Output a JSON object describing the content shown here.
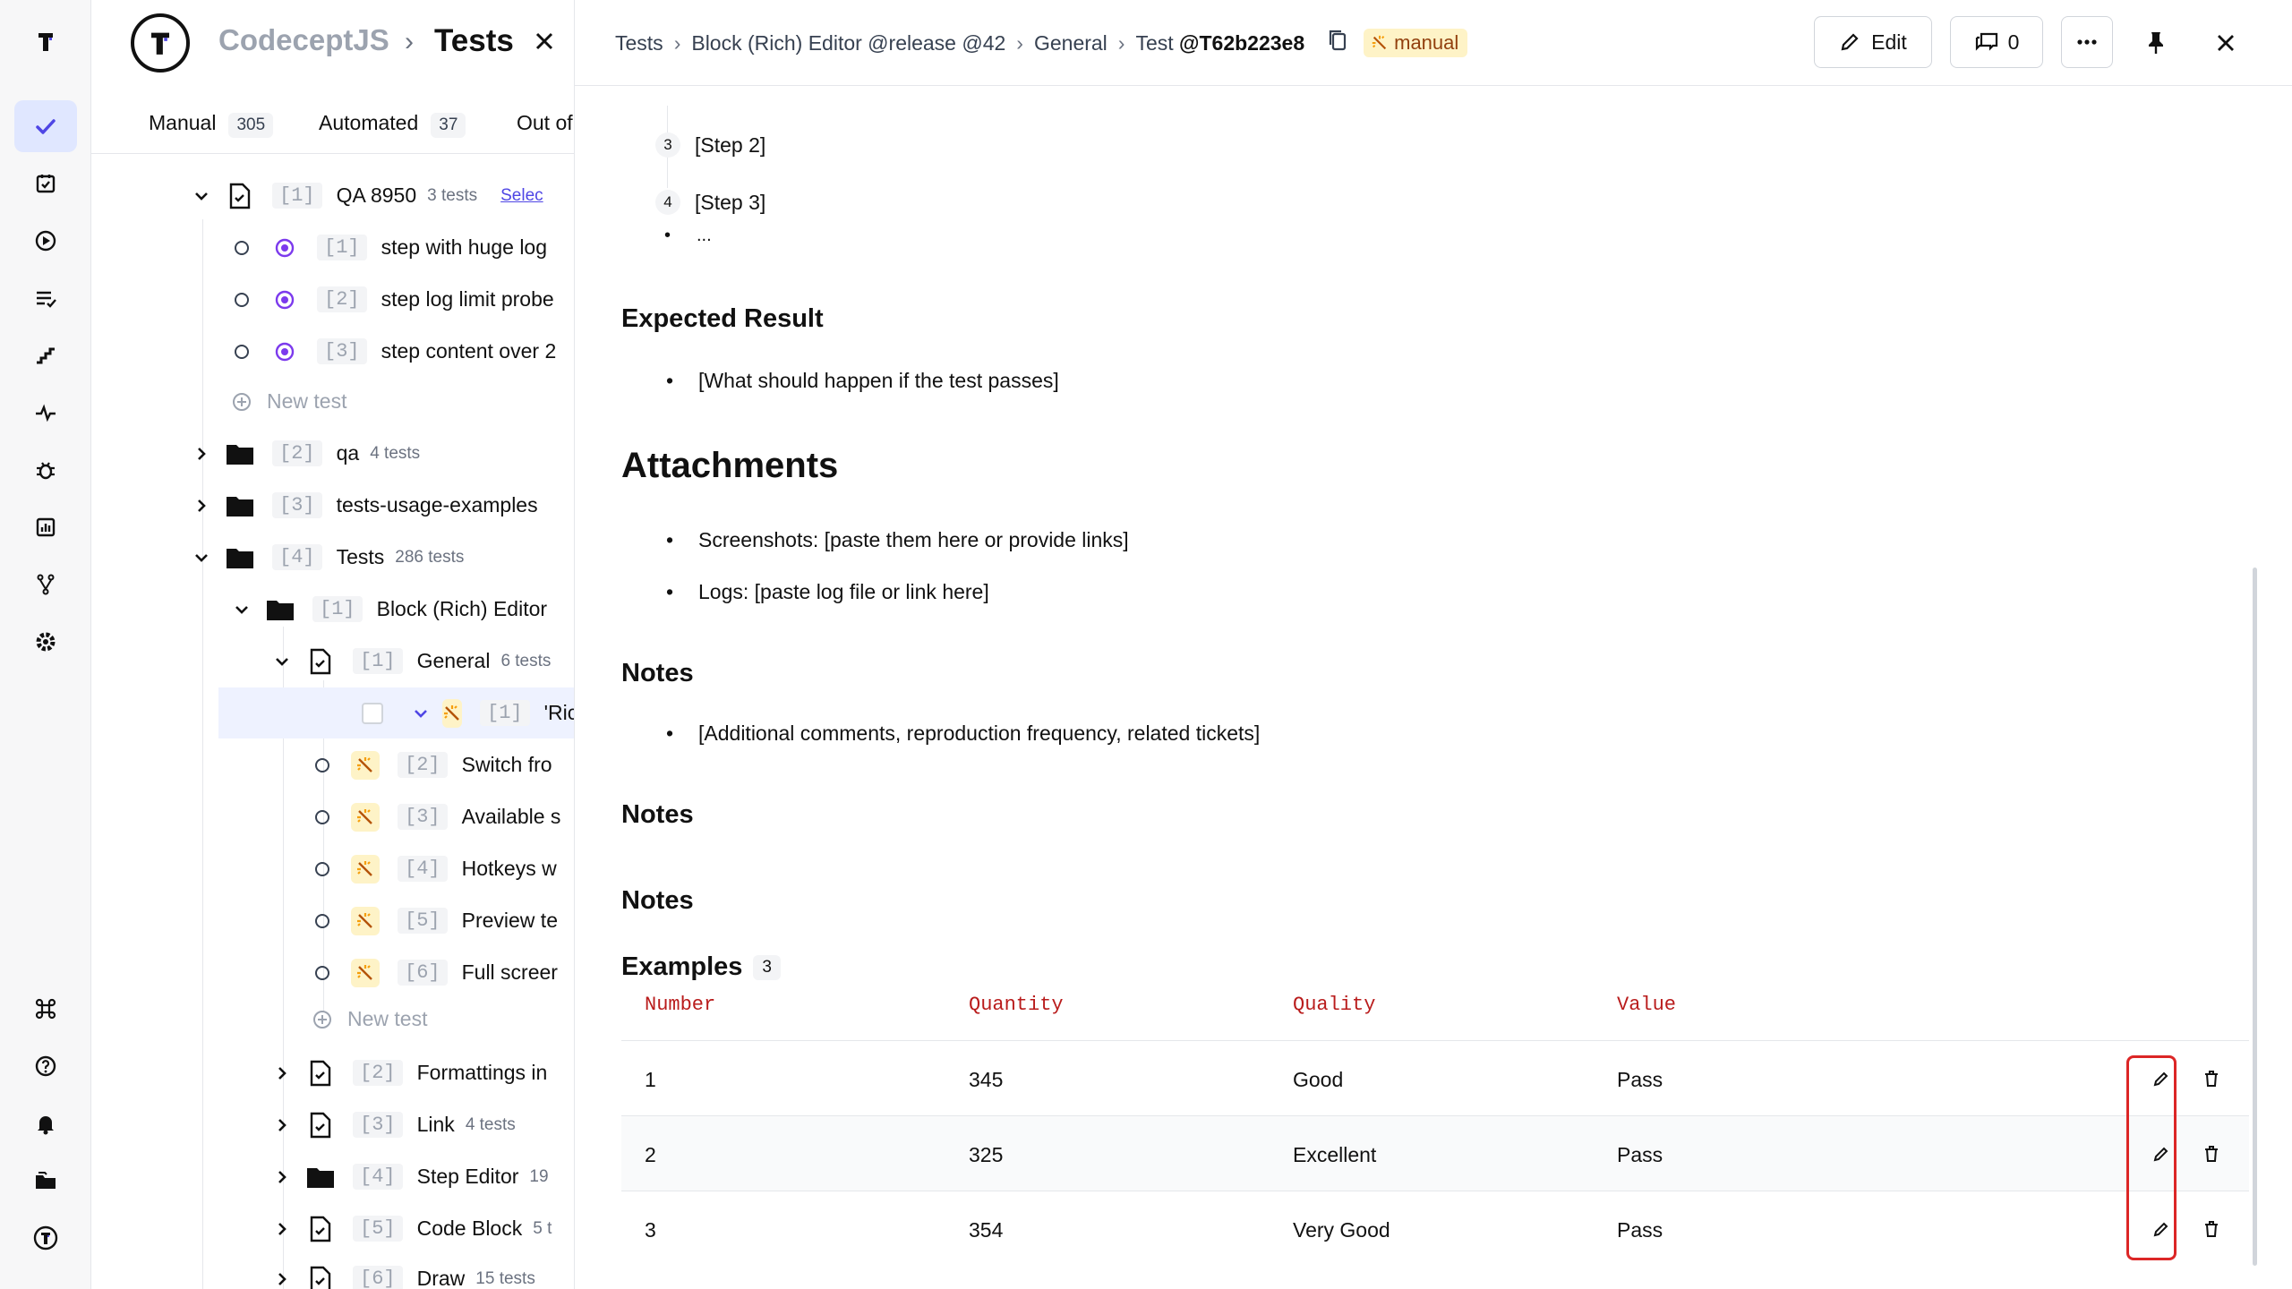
{
  "rail": {
    "items": [
      "logo-icon",
      "tests-icon",
      "checklist-icon",
      "runs-icon",
      "plans-icon",
      "steps-icon",
      "pulse-icon",
      "bug-icon",
      "analytics-icon",
      "branches-icon",
      "settings-icon",
      "command-icon",
      "help-icon",
      "notifications-icon",
      "projects-icon",
      "profile-icon"
    ],
    "accent": "#4f46e5"
  },
  "tree": {
    "project": "CodeceptJS",
    "sep": "›",
    "title": "Tests",
    "tabs": [
      {
        "label": "Manual",
        "count": "305"
      },
      {
        "label": "Automated",
        "count": "37"
      },
      {
        "label": "Out of"
      }
    ],
    "select_label": "Selec",
    "new_test": "New test",
    "rows": [
      {
        "idx": "[1]",
        "label": "QA 8950",
        "sub": "3 tests"
      },
      {
        "idx": "[1]",
        "label": "step with huge log"
      },
      {
        "idx": "[2]",
        "label": "step log limit probe"
      },
      {
        "idx": "[3]",
        "label": "step content over 2"
      },
      {
        "idx": "[2]",
        "label": "qa",
        "sub": "4 tests"
      },
      {
        "idx": "[3]",
        "label": "tests-usage-examples"
      },
      {
        "idx": "[4]",
        "label": "Tests",
        "sub": "286 tests"
      },
      {
        "idx": "[1]",
        "label": "Block (Rich) Editor"
      },
      {
        "idx": "[1]",
        "label": "General",
        "sub": "6 tests"
      },
      {
        "idx": "[1]",
        "label": "'Rich edito"
      },
      {
        "idx": "[2]",
        "label": "Switch fro"
      },
      {
        "idx": "[3]",
        "label": "Available s"
      },
      {
        "idx": "[4]",
        "label": "Hotkeys w"
      },
      {
        "idx": "[5]",
        "label": "Preview te"
      },
      {
        "idx": "[6]",
        "label": "Full screer"
      },
      {
        "idx": "[2]",
        "label": "Formattings in"
      },
      {
        "idx": "[3]",
        "label": "Link",
        "sub": "4 tests"
      },
      {
        "idx": "[4]",
        "label": "Step Editor",
        "sub": "19"
      },
      {
        "idx": "[5]",
        "label": "Code Block",
        "sub": "5 t"
      },
      {
        "idx": "[6]",
        "label": "Draw",
        "sub": "15 tests"
      }
    ]
  },
  "detail": {
    "breadcrumb": [
      "Tests",
      "Block (Rich) Editor @release @42",
      "General"
    ],
    "test_prefix": "Test",
    "test_id": "@T62b223e8",
    "badge": "manual",
    "edit_label": "Edit",
    "comments_count": "0",
    "steps": [
      {
        "num": "3",
        "text": "[Step 2]"
      },
      {
        "num": "4",
        "text": "[Step 3]"
      }
    ],
    "ellipsis": "...",
    "expected_title": "Expected Result",
    "expected_items": [
      "[What should happen if the test passes]"
    ],
    "attachments_title": "Attachments",
    "attachments_items": [
      "Screenshots: [paste them here or provide links]",
      "Logs: [paste log file or link here]"
    ],
    "notes_title": "Notes",
    "notes_items": [
      "[Additional comments, reproduction frequency, related tickets]"
    ],
    "notes_title_2": "Notes",
    "notes_title_3": "Notes",
    "examples_title": "Examples",
    "examples_count": "3",
    "table": {
      "headers": [
        "Number",
        "Quantity",
        "Quality",
        "Value"
      ],
      "rows": [
        [
          "1",
          "345",
          "Good",
          "Pass"
        ],
        [
          "2",
          "325",
          "Excellent",
          "Pass"
        ],
        [
          "3",
          "354",
          "Very Good",
          "Pass"
        ]
      ]
    }
  }
}
